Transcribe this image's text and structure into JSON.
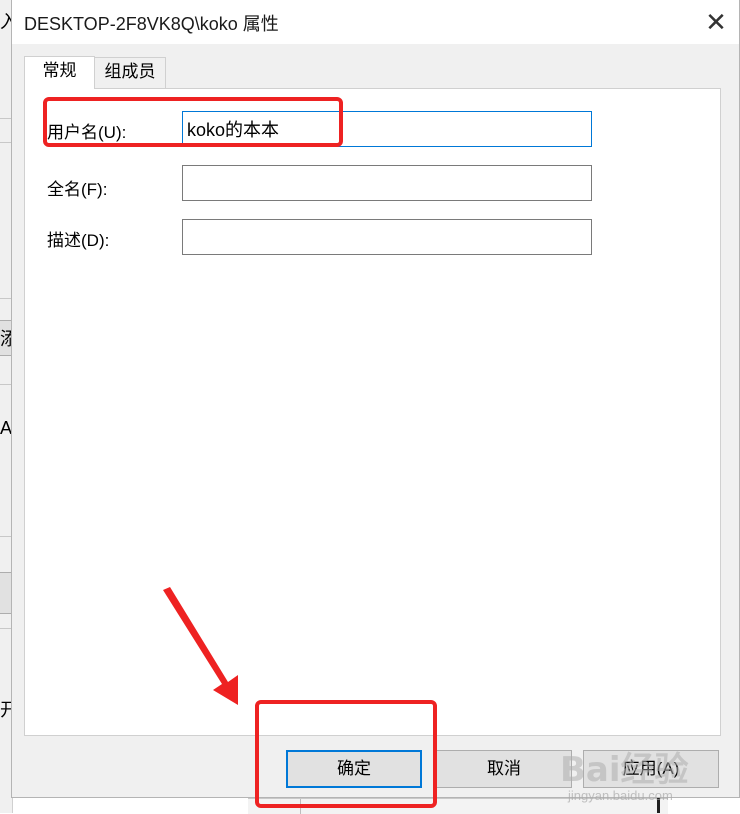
{
  "background_window": {
    "fragments": [
      "入",
      "添",
      "Al",
      "开"
    ]
  },
  "dialog": {
    "title": "DESKTOP-2F8VK8Q\\koko 属性",
    "close_glyph": "✕",
    "tabs": [
      {
        "label": "常规",
        "active": true
      },
      {
        "label": "组成员",
        "active": false
      }
    ],
    "fields": {
      "username": {
        "label": "用户名(U):",
        "value": "koko的本本"
      },
      "fullname": {
        "label": "全名(F):",
        "value": ""
      },
      "description": {
        "label": "描述(D):",
        "value": ""
      }
    },
    "buttons": {
      "ok": "确定",
      "cancel": "取消",
      "apply": "应用(A)"
    }
  },
  "watermark": {
    "logo_text": "Bai经验",
    "sub_text": "jingyan.baidu.com"
  },
  "colors": {
    "annotation_red": "#ee2222",
    "focus_blue": "#0078d7",
    "dialog_bg": "#f0f0f0"
  }
}
